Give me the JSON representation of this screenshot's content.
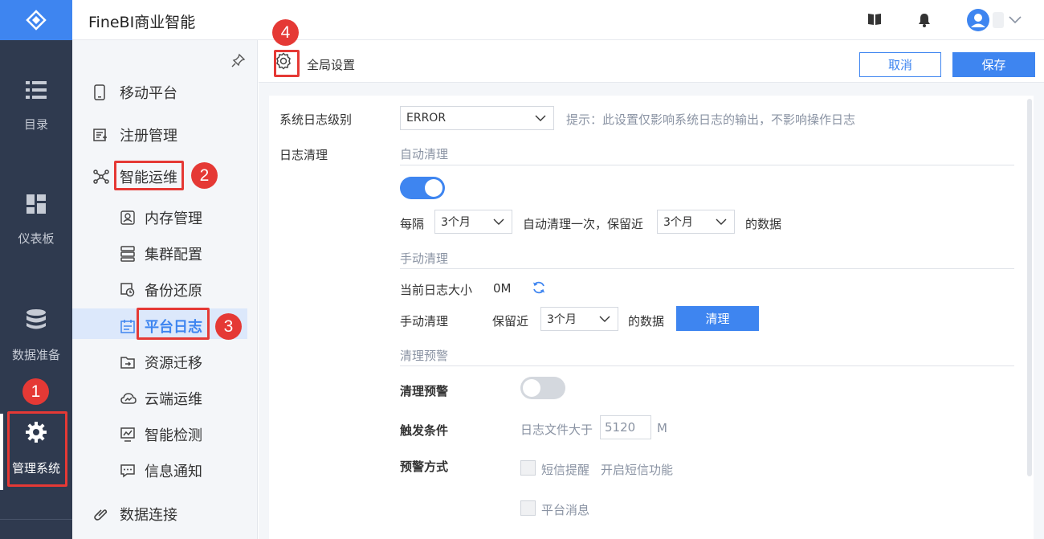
{
  "app": {
    "title": "FineBI商业智能"
  },
  "rail": {
    "items": [
      {
        "label": "目录",
        "icon": "list-icon"
      },
      {
        "label": "仪表板",
        "icon": "dashboard-icon"
      },
      {
        "label": "数据准备",
        "icon": "database-icon"
      },
      {
        "label": "管理系统",
        "icon": "gear-icon"
      }
    ]
  },
  "sidebar": {
    "items": [
      {
        "label": "移动平台",
        "icon": "mobile-icon"
      },
      {
        "label": "注册管理",
        "icon": "register-icon"
      },
      {
        "label": "智能运维",
        "icon": "ops-icon"
      },
      {
        "label": "内存管理",
        "icon": "memory-icon"
      },
      {
        "label": "集群配置",
        "icon": "cluster-icon"
      },
      {
        "label": "备份还原",
        "icon": "backup-icon"
      },
      {
        "label": "平台日志",
        "icon": "log-icon"
      },
      {
        "label": "资源迁移",
        "icon": "migrate-icon"
      },
      {
        "label": "云端运维",
        "icon": "cloud-icon"
      },
      {
        "label": "智能检测",
        "icon": "monitor-icon"
      },
      {
        "label": "信息通知",
        "icon": "message-icon"
      },
      {
        "label": "数据连接",
        "icon": "link-icon"
      }
    ]
  },
  "main": {
    "title": "全局设置",
    "cancel_label": "取消",
    "save_label": "保存"
  },
  "settings": {
    "log_level_label": "系统日志级别",
    "log_level_value": "ERROR",
    "log_level_hint": "提示：此设置仅影响系统日志的输出，不影响操作日志",
    "log_clean_label": "日志清理",
    "auto_clean_title": "自动清理",
    "auto_clean_enabled": true,
    "every_label": "每隔",
    "interval_value": "3个月",
    "auto_mid_text": "自动清理一次，保留近",
    "retain_value": "3个月",
    "data_suffix": "的数据",
    "manual_clean_title": "手动清理",
    "current_size_label": "当前日志大小",
    "current_size_value": "0M",
    "manual_clean_label": "手动清理",
    "retain_label": "保留近",
    "manual_retain_value": "3个月",
    "manual_data_suffix": "的数据",
    "clean_button": "清理",
    "warning_title": "清理预警",
    "warning_label": "清理预警",
    "warning_enabled": false,
    "trigger_label": "触发条件",
    "trigger_text": "日志文件大于",
    "trigger_value": "5120",
    "trigger_unit": "M",
    "method_label": "预警方式",
    "sms_label": "短信提醒",
    "sms_hint": "开启短信功能",
    "platform_msg_label": "平台消息"
  },
  "annotations": [
    "1",
    "2",
    "3",
    "4"
  ],
  "colors": {
    "accent": "#3e85f0",
    "rail": "#2f3a4f",
    "annotation": "#e53935"
  }
}
